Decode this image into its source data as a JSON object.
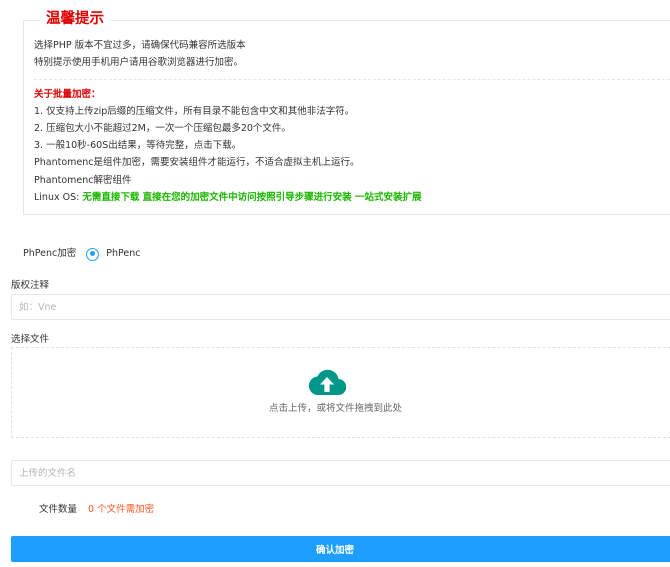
{
  "notice": {
    "title": "温馨提示",
    "lines": [
      "选择PHP 版本不宜过多，请确保代码兼容所选版本",
      "特别提示使用手机用户请用谷歌浏览器进行加密。"
    ],
    "batch_heading": "关于批量加密：",
    "batch_items": [
      "1. 仅支持上传zip后缀的压缩文件，所有目录不能包含中文和其他非法字符。",
      "2. 压缩包大小不能超过2M，一次一个压缩包最多20个文件。",
      "3. 一般10秒-60S出结果，等待完整，点击下载。",
      "Phantomenc是组件加密，需要安装组件才能运行，不适合虚拟主机上运行。",
      "Phantomenc解密组件"
    ],
    "linux_label": "Linux OS: ",
    "linux_highlight": "无需直接下载 直接在您的加密文件中访问按照引导步骤进行安装 一站式安装扩展"
  },
  "encrypt_type": {
    "label": "PhPenc加密",
    "option": "PhPenc",
    "selected": true
  },
  "copyright": {
    "label": "版权注释",
    "placeholder": "如：Vne",
    "value": ""
  },
  "file_select": {
    "label": "选择文件",
    "drop_text": "点击上传，或将文件拖拽到此处",
    "icon": "cloud-upload-icon",
    "icon_color": "#009688"
  },
  "uploaded_name": {
    "placeholder": "上传的文件名",
    "value": ""
  },
  "file_count": {
    "label": "文件数量",
    "value": "0 个文件需加密"
  },
  "submit": {
    "label": "确认加密",
    "color": "#1e9fff"
  }
}
